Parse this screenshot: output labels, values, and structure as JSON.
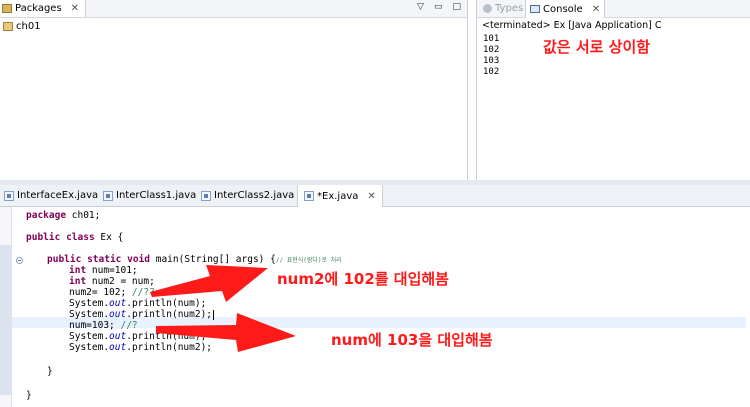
{
  "packages_view": {
    "tab_label": "Packages",
    "close_glyph": "✕",
    "menu_glyph": "▽",
    "tree_item": "ch01"
  },
  "console_view": {
    "types_tab": "Types",
    "console_tab": "Console",
    "close_glyph": "✕",
    "terminated_text": "<terminated> Ex [Java Application] C",
    "output_lines": [
      "101",
      "102",
      "103",
      "102"
    ],
    "annotation": "값은 서로 상이함"
  },
  "editor": {
    "tabs": [
      {
        "label": "InterfaceEx.java"
      },
      {
        "label": "InterClass1.java"
      },
      {
        "label": "InterClass2.java"
      },
      {
        "label": "*Ex.java",
        "close": "✕"
      }
    ],
    "code": {
      "pkg": "package ch01;",
      "cls": "public class Ex {",
      "main_sig": "public static void main(String[] args) {",
      "main_comment": "// 표현식(람다)로 처리",
      "l1": "int num=101;",
      "l2": "int num2 = num;",
      "l3_code": "num2= 102; ",
      "l3_comment": "//??",
      "l4_a": "System.",
      "l4_out": "out",
      "l4_b": ".println(num);",
      "l5_b": ".println(num2);",
      "l6_code": "num=103; ",
      "l6_comment": "//?",
      "close_method": "}",
      "close_class": "}"
    }
  },
  "annotations": {
    "arrow1": "num2에 102를 대입해봄",
    "arrow2": "num에 103을 대입해봄"
  },
  "colors": {
    "annotation_red": "#ff1a1a",
    "keyword": "#7f0055",
    "field": "#0000c0",
    "comment": "#3f7f5f"
  }
}
